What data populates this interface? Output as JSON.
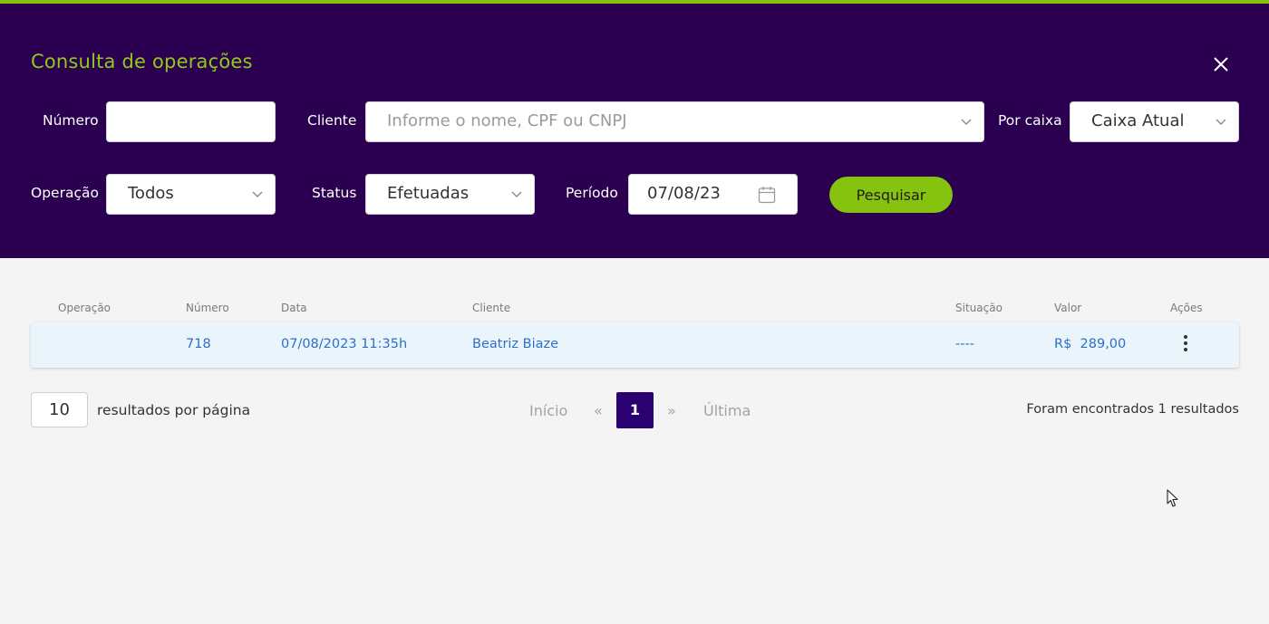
{
  "header": {
    "title": "Consulta de operações",
    "accent_color": "#86c30e",
    "background_color": "#2b0050"
  },
  "filters": {
    "numero_label": "Número",
    "numero_value": "",
    "cliente_label": "Cliente",
    "cliente_placeholder": "Informe o nome, CPF ou CNPJ",
    "por_caixa_label": "Por caixa",
    "por_caixa_value": "Caixa Atual",
    "operacao_label": "Operação",
    "operacao_value": "Todos",
    "status_label": "Status",
    "status_value": "Efetuadas",
    "periodo_label": "Período",
    "periodo_value": "07/08/23",
    "search_button": "Pesquisar"
  },
  "table": {
    "columns": [
      "Operação",
      "Número",
      "Data",
      "Cliente",
      "Situação",
      "Valor",
      "Ações"
    ],
    "rows": [
      {
        "operacao": "",
        "numero": "718",
        "data": "07/08/2023 11:35h",
        "cliente": "Beatriz Biaze",
        "situacao": "----",
        "valor": "R$  289,00"
      }
    ]
  },
  "pagination": {
    "per_page": "10",
    "per_page_label": "resultados por página",
    "first": "Início",
    "prev": "«",
    "current": "1",
    "next": "»",
    "last": "Última",
    "results_text": "Foram encontrados 1 resultados"
  }
}
